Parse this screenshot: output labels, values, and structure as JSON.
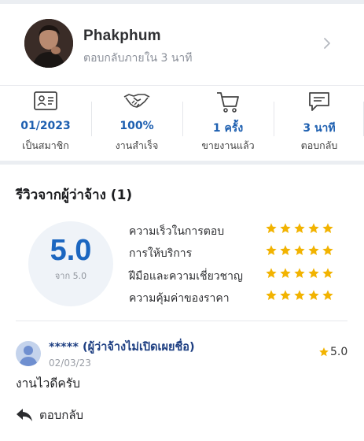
{
  "seller": {
    "name": "Phakphum",
    "response_time": "ตอบกลับภายใน 3 นาที"
  },
  "stats": [
    {
      "icon": "id-card-icon",
      "value": "01/2023",
      "label": "เป็นสมาชิก"
    },
    {
      "icon": "handshake-icon",
      "value": "100%",
      "label": "งานสำเร็จ"
    },
    {
      "icon": "cart-icon",
      "value": "1 ครั้ง",
      "label": "ขายงานแล้ว"
    },
    {
      "icon": "chat-icon",
      "value": "3 นาที",
      "label": "ตอบกลับ"
    }
  ],
  "reviews": {
    "title": "รีวิวจากผู้ว่าจ้าง (1)",
    "score": "5.0",
    "score_sub": "จาก 5.0",
    "criteria": [
      {
        "label": "ความเร็วในการตอบ",
        "stars": 5
      },
      {
        "label": "การให้บริการ",
        "stars": 5
      },
      {
        "label": "ฝีมือและความเชี่ยวชาญ",
        "stars": 5
      },
      {
        "label": "ความคุ้มค่าของราคา",
        "stars": 5
      }
    ],
    "items": [
      {
        "reviewer": "***** (ผู้ว่าจ้างไม่เปิดเผยชื่อ)",
        "date": "02/03/23",
        "rating": "5.0",
        "text": "งานไวดีครับ"
      }
    ],
    "reply_label": "ตอบกลับ"
  },
  "colors": {
    "accent": "#1d5fb0",
    "star": "#f2b300",
    "background": "#ebeef2"
  }
}
